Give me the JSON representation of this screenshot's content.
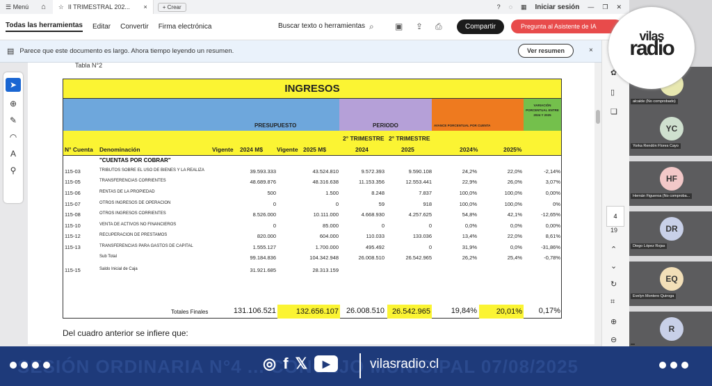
{
  "titlebar": {
    "menu": "Menú",
    "tab_title": "II TRIMESTRAL 202...",
    "tab_close": "×",
    "new_tab": "+ Crear",
    "sign_in": "Iniciar sesión"
  },
  "toolbar": {
    "all_tools": "Todas las herramientas",
    "edit": "Editar",
    "convert": "Convertir",
    "esign": "Firma electrónica",
    "search": "Buscar texto o herramientas",
    "share": "Compartir",
    "ask": "Pregunta al Asistente de IA"
  },
  "banner": {
    "text": "Parece que este documento es largo. Ahora tiempo leyendo un resumen.",
    "button": "Ver resumen",
    "close": "×"
  },
  "doc": {
    "tabla_label": "Tabla N°2",
    "title": "INGRESOS",
    "presupuesto": "PRESUPUESTO",
    "periodo": "PERIODO",
    "avance": "AVANCE PORCENTUAL POR CUENTA",
    "variacion": "VARIACIÓN PORCENTUAL ENTRE 2024 Y 2025",
    "cols": {
      "cta": "N° Cuenta",
      "den": "Denominación",
      "vig1": "Vigente",
      "m24": "2024 M$",
      "vig2": "Vigente",
      "m25": "2025 M$",
      "t24a": "2° TRIMESTRE",
      "t24b": "2024",
      "t25a": "2° TRIMESTRE",
      "t25b": "2025",
      "p24": "2024%",
      "p25": "2025%"
    },
    "section": "\"CUENTAS POR COBRAR\"",
    "rows": [
      {
        "cta": "115-03",
        "den": "TRIBUTOS SOBRE EL USO DE BIENES Y LA REALIZA",
        "v24": "39.593.333",
        "v25": "43.524.810",
        "p24": "9.572.393",
        "p25": "9.590.108",
        "a24": "24,2%",
        "a25": "22,0%",
        "var": "-2,14%"
      },
      {
        "cta": "115-05",
        "den": "TRANSFERENCIAS CORRIENTES",
        "v24": "48.689.876",
        "v25": "48.316.638",
        "p24": "11.153.356",
        "p25": "12.553.441",
        "a24": "22,9%",
        "a25": "26,0%",
        "var": "3,07%"
      },
      {
        "cta": "115-06",
        "den": "RENTAS DE LA PROPIEDAD",
        "v24": "500",
        "v25": "1.500",
        "p24": "8.248",
        "p25": "7.837",
        "a24": "100,0%",
        "a25": "100,0%",
        "var": "0,00%"
      },
      {
        "cta": "115-07",
        "den": "OTROS INGRESOS DE OPERACION",
        "v24": "0",
        "v25": "0",
        "p24": "59",
        "p25": "918",
        "a24": "100,0%",
        "a25": "100,0%",
        "var": "0%"
      },
      {
        "cta": "115-08",
        "den": "OTROS INGRESOS CORRIENTES",
        "v24": "8.526.000",
        "v25": "10.111.000",
        "p24": "4.668.930",
        "p25": "4.257.625",
        "a24": "54,8%",
        "a25": "42,1%",
        "var": "-12,65%"
      },
      {
        "cta": "115-10",
        "den": "VENTA DE ACTIVOS NO FINANCIEROS",
        "v24": "0",
        "v25": "85.000",
        "p24": "0",
        "p25": "0",
        "a24": "0,0%",
        "a25": "0,0%",
        "var": "0,00%"
      },
      {
        "cta": "115-12",
        "den": "RECUPERACION DE PRESTAMOS",
        "v24": "820.000",
        "v25": "604.000",
        "p24": "110.033",
        "p25": "133.036",
        "a24": "13,4%",
        "a25": "22,0%",
        "var": "8,61%"
      },
      {
        "cta": "115-13",
        "den": "TRANSFERENCIAS PARA GASTOS DE CAPITAL",
        "v24": "1.555.127",
        "v25": "1.700.000",
        "p24": "495.492",
        "p25": "0",
        "a24": "31,9%",
        "a25": "0,0%",
        "var": "-31,86%"
      },
      {
        "cta": "",
        "den": "Sub Total",
        "v24": "99.184.836",
        "v25": "104.342.948",
        "p24": "26.008.510",
        "p25": "26.542.965",
        "a24": "26,2%",
        "a25": "25,4%",
        "var": "-0,78%"
      },
      {
        "cta": "115-15",
        "den": "Saldo Inicial de Caja",
        "v24": "31.921.685",
        "v25": "28.313.159",
        "p24": "",
        "p25": "",
        "a24": "",
        "a25": "",
        "var": ""
      }
    ],
    "totales": {
      "label": "Totales Finales",
      "v24": "131.106.521",
      "v25": "132.656.107",
      "p24": "26.008.510",
      "p25": "26.542.965",
      "a24": "19,84%",
      "a25": "20,01%",
      "var": "0,17%"
    },
    "footer": "Del cuadro anterior se infiere que:"
  },
  "rightpanel": {
    "page_current": "4",
    "page_total": "19"
  },
  "participants": [
    {
      "initials": "",
      "name": "alcalde (No comprobado)"
    },
    {
      "initials": "YC",
      "name": "Yorka Rendón Flores Cayo"
    },
    {
      "initials": "HF",
      "name": "Hernán Figueroa (No comproba..."
    },
    {
      "initials": "DR",
      "name": "Diego López Rojas"
    },
    {
      "initials": "EQ",
      "name": "Evelyn Montero Quiroga"
    },
    {
      "initials": "R",
      "name": ""
    }
  ],
  "logo": {
    "line1": "vilas",
    "line2": "radio"
  },
  "bottom": {
    "ticker": "SESIÓN ORDINARIA N°4 ... CONCEJO MUNICIPAL 07/08/2025",
    "url": "vilasradio.cl"
  },
  "colors": {
    "yellow": "#fbf433",
    "blue": "#6ea7dc",
    "purple": "#b5a0d8",
    "orange": "#ee7a1f",
    "green": "#74c04c",
    "navy": "#1e3a7a"
  }
}
